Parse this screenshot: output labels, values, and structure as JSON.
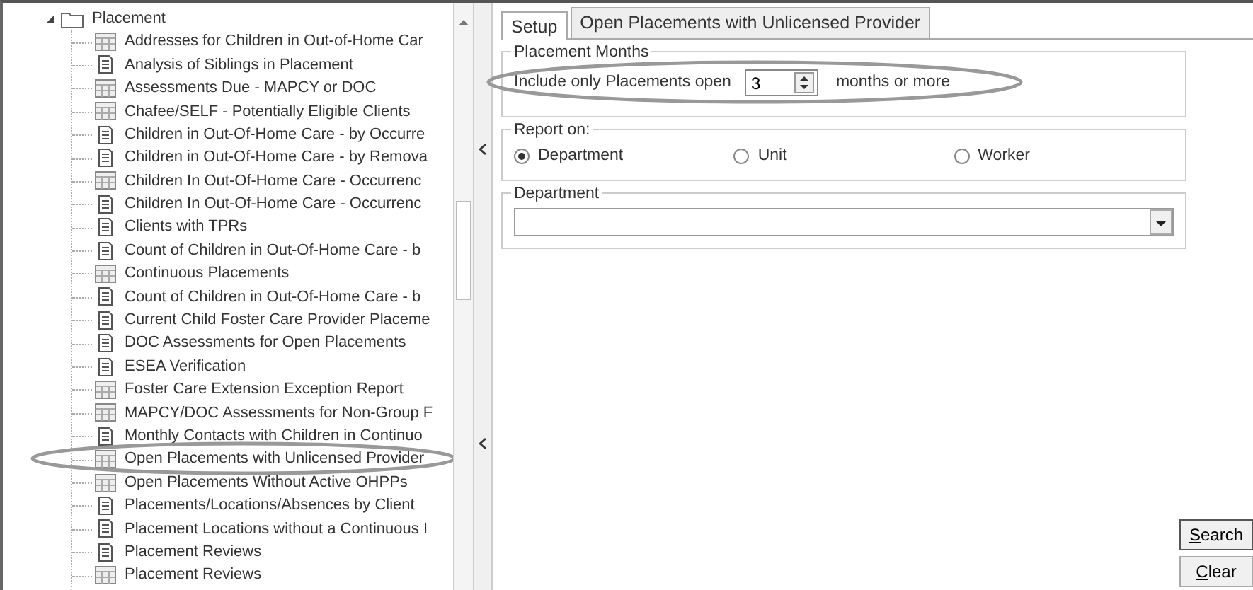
{
  "tree": {
    "label": "Placement",
    "expanded": true,
    "children": [
      {
        "label": "Addresses for Children in Out-of-Home Car",
        "kind": "grid",
        "circled": false
      },
      {
        "label": "Analysis of Siblings in Placement",
        "kind": "doc",
        "circled": false
      },
      {
        "label": "Assessments Due - MAPCY or DOC",
        "kind": "grid",
        "circled": false
      },
      {
        "label": "Chafee/SELF - Potentially Eligible Clients",
        "kind": "grid",
        "circled": false
      },
      {
        "label": "Children in Out-Of-Home Care - by Occurre",
        "kind": "doc",
        "circled": false
      },
      {
        "label": "Children in Out-Of-Home Care - by Remova",
        "kind": "doc",
        "circled": false
      },
      {
        "label": "Children In Out-Of-Home Care - Occurrenc",
        "kind": "grid",
        "circled": false
      },
      {
        "label": "Children In Out-Of-Home Care - Occurrenc",
        "kind": "doc",
        "circled": false
      },
      {
        "label": "Clients with TPRs",
        "kind": "doc",
        "circled": false
      },
      {
        "label": "Count of Children in Out-Of-Home Care - b",
        "kind": "doc",
        "circled": false
      },
      {
        "label": "Continuous Placements",
        "kind": "grid",
        "circled": false
      },
      {
        "label": "Count of Children in Out-Of-Home Care - b",
        "kind": "doc",
        "circled": false
      },
      {
        "label": "Current Child Foster Care Provider Placeme",
        "kind": "doc",
        "circled": false
      },
      {
        "label": "DOC Assessments for Open Placements",
        "kind": "doc",
        "circled": false
      },
      {
        "label": "ESEA Verification",
        "kind": "doc",
        "circled": false
      },
      {
        "label": "Foster Care Extension Exception Report",
        "kind": "grid",
        "circled": false
      },
      {
        "label": "MAPCY/DOC Assessments for Non-Group F",
        "kind": "grid",
        "circled": false
      },
      {
        "label": "Monthly Contacts with Children in Continuo",
        "kind": "doc",
        "circled": false
      },
      {
        "label": "Open Placements with Unlicensed Provider",
        "kind": "grid",
        "circled": true
      },
      {
        "label": "Open Placements Without Active OHPPs",
        "kind": "grid",
        "circled": false
      },
      {
        "label": "Placements/Locations/Absences by Client",
        "kind": "doc",
        "circled": false
      },
      {
        "label": "Placement Locations without a Continuous I",
        "kind": "doc",
        "circled": false
      },
      {
        "label": "Placement Reviews",
        "kind": "doc",
        "circled": false
      },
      {
        "label": "Placement Reviews",
        "kind": "grid",
        "circled": false
      }
    ]
  },
  "tabs": [
    {
      "label": "Setup",
      "selected": true
    },
    {
      "label": "Open Placements with Unlicensed Provider",
      "selected": false
    }
  ],
  "placement_months": {
    "title": "Placement Months",
    "label": "Include only Placements open",
    "value": "3",
    "suffix": "months or more",
    "circled": true
  },
  "report_on": {
    "title": "Report on:",
    "options": [
      {
        "label": "Department",
        "selected": true
      },
      {
        "label": "Unit",
        "selected": false
      },
      {
        "label": "Worker",
        "selected": false
      }
    ]
  },
  "department": {
    "title": "Department"
  },
  "buttons": [
    {
      "key": "S",
      "rest": "earch",
      "default": true
    },
    {
      "key": "C",
      "rest": "lear",
      "default": false
    }
  ]
}
